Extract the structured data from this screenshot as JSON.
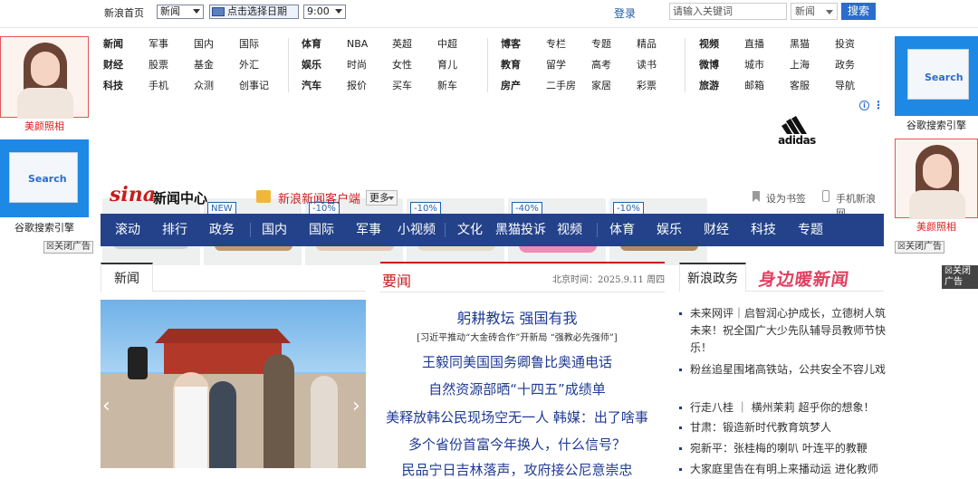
{
  "topbar": {
    "home": "新浪首页",
    "channel_select": "新闻",
    "date_picker": "点击选择日期",
    "time_select": "9:00",
    "login": "登录",
    "search_placeholder": "请输入关键词",
    "search_scope": "新闻",
    "search_button": "搜索"
  },
  "nav": {
    "group1": [
      [
        "新闻",
        "军事",
        "国内",
        "国际"
      ],
      [
        "财经",
        "股票",
        "基金",
        "外汇"
      ],
      [
        "科技",
        "手机",
        "众测",
        "创事记"
      ]
    ],
    "group2": [
      [
        "体育",
        "NBA",
        "英超",
        "中超"
      ],
      [
        "娱乐",
        "时尚",
        "女性",
        "育儿"
      ],
      [
        "汽车",
        "报价",
        "买车",
        "新车"
      ]
    ],
    "group3": [
      [
        "博客",
        "专栏",
        "专题",
        "精品"
      ],
      [
        "教育",
        "留学",
        "高考",
        "读书"
      ],
      [
        "房产",
        "二手房",
        "家居",
        "彩票"
      ]
    ],
    "group4": [
      [
        "视频",
        "直播",
        "黑猫",
        "投资"
      ],
      [
        "微博",
        "城市",
        "上海",
        "政务"
      ],
      [
        "旅游",
        "邮箱",
        "客服",
        "导航"
      ]
    ]
  },
  "ad": {
    "badges": [
      "NEW",
      "-10%",
      "-10%",
      "-40%",
      "-10%"
    ],
    "brand": "adidas",
    "info_icon": "i",
    "more_icon": "⋮"
  },
  "side_ads": {
    "left_top_label": "美颜照相",
    "left_bottom_label": "谷歌搜索引擎",
    "right_top_label": "谷歌搜索引擎",
    "right_bottom_label": "美颜照相",
    "close_label": "关闭广告",
    "search_logo": "Search",
    "ad_tag": "广告"
  },
  "brand": {
    "logo_sina": "sina",
    "logo_text": "新闻中心",
    "client": "新浪新闻客户端",
    "more": "更多",
    "bookmark": "设为书签",
    "mobile": "手机新浪网"
  },
  "bluenav": [
    "滚动",
    "排行",
    "政务",
    "国内",
    "国际",
    "军事",
    "小视频",
    "文化",
    "黑猫投诉",
    "视频",
    "体育",
    "娱乐",
    "财经",
    "科技",
    "专题"
  ],
  "left_col": {
    "tab": "新闻"
  },
  "center_col": {
    "title": "要闻",
    "time": "北京时间：2025.9.11 周四",
    "headlines": [
      "躬耕教坛 强国有我",
      "[习近平推动“大金砖合作”开新局 “强教必先强师”]",
      "王毅同美国国务卿鲁比奥通电话",
      "自然资源部晒“十四五”成绩单",
      "美释放韩公民现场空无一人 韩媒：出了啥事",
      "多个省份首富今年换人，什么信号？",
      "民品宁日吉林落声，攻府接公尼意崇忠"
    ]
  },
  "right_col": {
    "tab": "新浪政务",
    "banner": "身边暖新闻",
    "items": [
      "未来网评｜启智润心护成长，立德树人筑未来！祝全国广大少先队辅导员教师节快乐！",
      "粉丝追星围堵高铁站，公共安全不容儿戏",
      "行走八桂 ｜ 横州茉莉 超乎你的想象！",
      "甘肃：锻造新时代教育筑梦人",
      "宛新平：张桂梅的喇叭 叶连平的教鞭",
      "大家庭里告在有明上来播动运 进化教师"
    ]
  }
}
